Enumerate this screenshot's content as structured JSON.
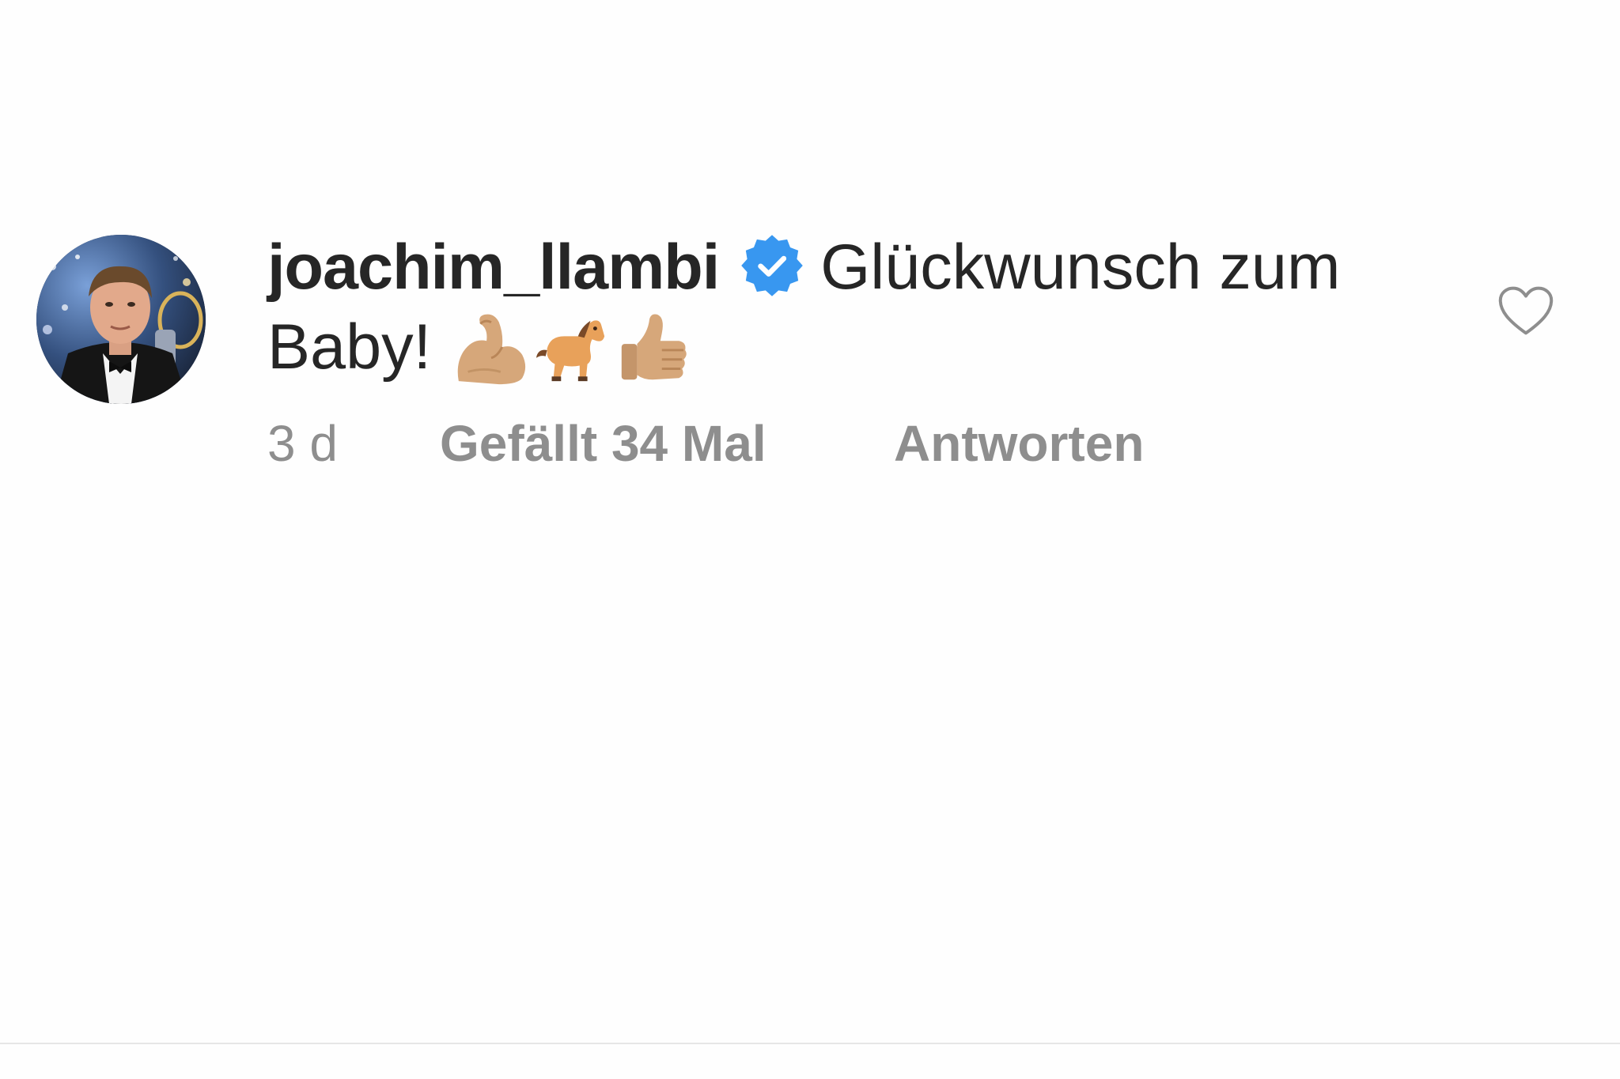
{
  "comment": {
    "username": "joachim_llambi",
    "verified": true,
    "text": "Glückwunsch zum Baby!",
    "emojis": [
      "flexed-biceps-icon",
      "horse-icon",
      "thumbs-up-icon"
    ],
    "timestamp": "3 d",
    "likes_label": "Gefällt 34 Mal",
    "reply_label": "Antworten"
  },
  "colors": {
    "text": "#262626",
    "meta": "#8e8e8e",
    "verified_badge": "#3897f0",
    "heart_outline": "#8e8e8e",
    "background": "#fefefe"
  },
  "icons": {
    "verified": "verified-badge-icon",
    "like": "heart-outline-icon"
  }
}
